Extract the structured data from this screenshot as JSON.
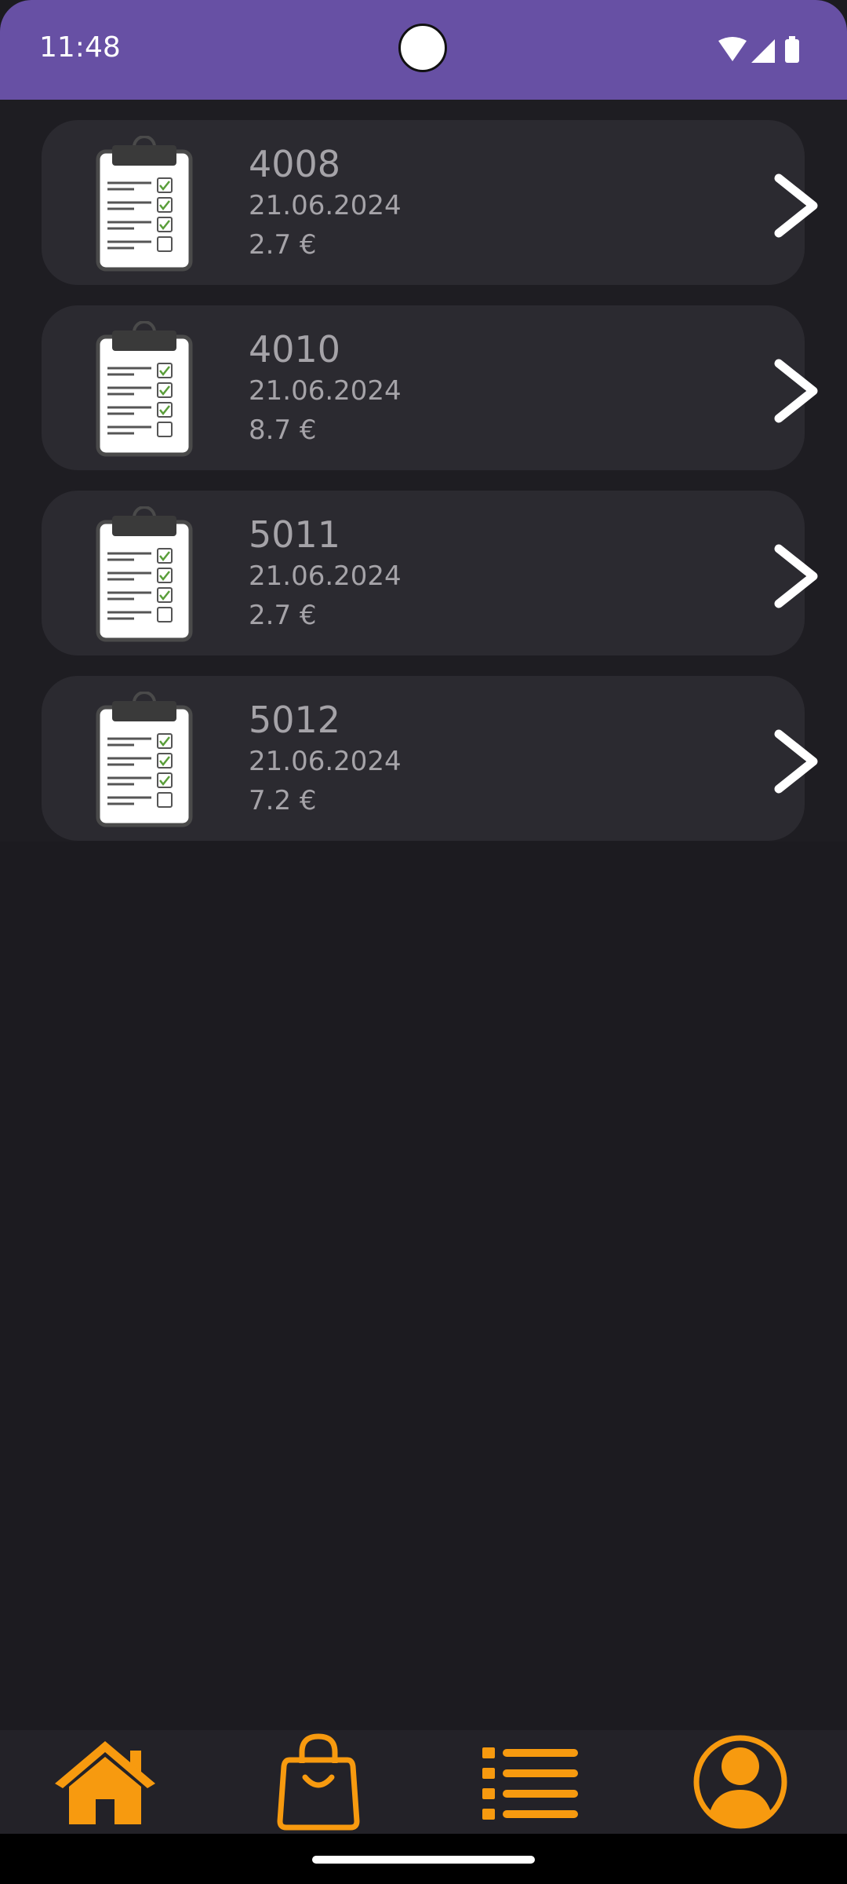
{
  "status_bar": {
    "time": "11:48",
    "icons": [
      "wifi-icon",
      "signal-icon",
      "battery-icon"
    ]
  },
  "orders": [
    {
      "number": "4008",
      "date": "21.06.2024",
      "price": "2.7 €"
    },
    {
      "number": "4010",
      "date": "21.06.2024",
      "price": "8.7 €"
    },
    {
      "number": "5011",
      "date": "21.06.2024",
      "price": "2.7 €"
    },
    {
      "number": "5012",
      "date": "21.06.2024",
      "price": "7.2 €"
    }
  ],
  "bottom_nav": {
    "items": [
      "home-icon",
      "shopping-bag-icon",
      "list-icon",
      "profile-icon"
    ],
    "accent_color": "#f79a0f"
  },
  "colors": {
    "status_bar": "#6750a4",
    "background": "#1c1b20",
    "card": "#2b2a30",
    "text_muted": "#a5a3a8"
  }
}
